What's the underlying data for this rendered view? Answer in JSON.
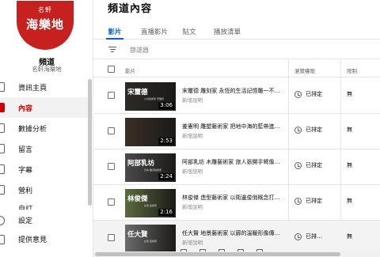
{
  "sidebar": {
    "logo": {
      "line1": "名軒",
      "line2": "海樂地",
      "bg_color": "#c6201f"
    },
    "channel_title": "頻道",
    "channel_name": "名軒海樂地",
    "items": [
      {
        "label": "資訊主頁",
        "icon": "dashboard-icon",
        "active": false
      },
      {
        "label": "內容",
        "icon": "content-icon",
        "active": true
      },
      {
        "label": "數據分析",
        "icon": "analytics-icon",
        "active": false
      },
      {
        "label": "留言",
        "icon": "comments-icon",
        "active": false
      },
      {
        "label": "字幕",
        "icon": "subtitles-icon",
        "active": false
      },
      {
        "label": "營利",
        "icon": "monetization-icon",
        "active": false
      },
      {
        "label": "自訂",
        "icon": "customize-icon",
        "active": false
      }
    ],
    "bottom_items": [
      {
        "label": "設定",
        "icon": "settings-icon"
      },
      {
        "label": "提供意見",
        "icon": "feedback-icon"
      }
    ]
  },
  "main": {
    "page_title": "頻道內容",
    "tabs": [
      {
        "label": "影片",
        "active": true
      },
      {
        "label": "直播影片",
        "active": false
      },
      {
        "label": "貼文",
        "active": false
      },
      {
        "label": "播放清單",
        "active": false
      }
    ],
    "filter_placeholder": "篩選器",
    "columns": {
      "video": "影片",
      "visibility": "瀏覽權限",
      "restrictions": "限制"
    },
    "accent_color": "#065fd4",
    "active_color": "#cc0000",
    "rows": [
      {
        "thumb_text": "宋璽德",
        "thumb_sub": "公共藝術家 宋璽德",
        "duration": "3:06",
        "title": "宋璽德 雕刻家 永恆的生活記憶雕一不…",
        "description": "新增說明",
        "visibility": "已排定",
        "restrictions": "無",
        "thumb_color": "#2d2a26"
      },
      {
        "thumb_text": "",
        "thumb_sub": "",
        "duration": "2:53",
        "title": "姜憲明 雕塑藝術家 把地中海的藍帶進…",
        "description": "新增說明",
        "visibility": "已排定",
        "restrictions": "無",
        "thumb_color": "#3a2f25"
      },
      {
        "thumb_text": "阿部乳坊",
        "thumb_sub": "日本 雕刻藝術家",
        "duration": "2:24",
        "title": "阿部乳坊 木雕藝術家 旅人張開手臂像…",
        "description": "新增說明",
        "visibility": "已排定",
        "restrictions": "無",
        "thumb_color": "#4a4a4a"
      },
      {
        "thumb_text": "林俊傑",
        "thumb_sub": "台灣 藝術家",
        "duration": "2:16",
        "title": "林俊傑 造型藝術家 以衛邊俊俏概念打…",
        "description": "新增說明",
        "visibility": "已排定",
        "restrictions": "無",
        "thumb_color": "#5a6b3e"
      },
      {
        "thumb_text": "任大賢",
        "thumb_sub": "台灣 藝術家",
        "duration": "",
        "title": "任大賢 地景藝術家 以廊的溫暖形像傳…",
        "description": "新增說明",
        "visibility": "已排…",
        "restrictions": "無",
        "thumb_color": "#6b6b6b"
      }
    ]
  }
}
